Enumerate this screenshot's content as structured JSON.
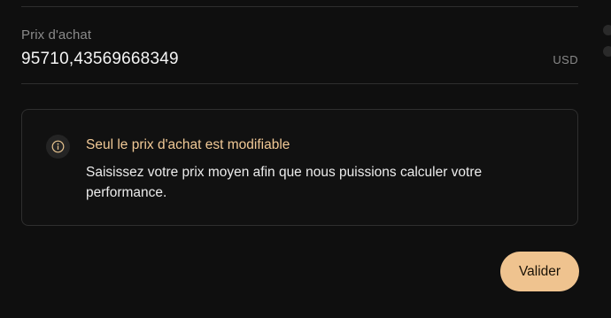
{
  "form": {
    "purchase_price_label": "Prix d'achat",
    "purchase_price_value": "95710,43569668349",
    "currency": "USD"
  },
  "notice": {
    "icon": "info-icon",
    "title": "Seul le prix d'achat est modifiable",
    "text": "Saisissez votre prix moyen afin que nous puissions calculer votre performance."
  },
  "actions": {
    "submit_label": "Valider"
  },
  "colors": {
    "background": "#0f0f0f",
    "accent": "#efc38f",
    "notice_title": "#f1c996",
    "muted_text": "#8a8a8a",
    "divider": "#2e2e2e"
  }
}
